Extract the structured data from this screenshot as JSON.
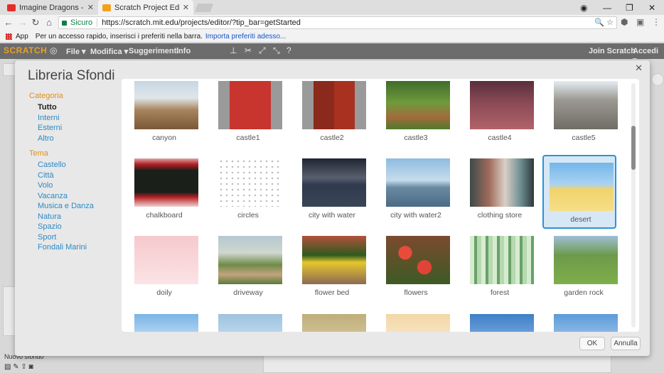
{
  "browser": {
    "tabs": [
      {
        "title": "Imagine Dragons - Go",
        "active": false,
        "favicon_color": "#e52d27"
      },
      {
        "title": "Scratch Project Editor - I",
        "active": true,
        "favicon_color": "#f4a01c"
      }
    ],
    "window_controls": {
      "user": "◉",
      "minimize": "—",
      "restore": "❐",
      "close": "✕"
    },
    "address": {
      "secure_label": "Sicuro",
      "url": "https://scratch.mit.edu/projects/editor/?tip_bar=getStarted"
    },
    "bookmarks": {
      "apps_label": "App",
      "hint": "Per un accesso rapido, inserisci i preferiti nella barra.",
      "import_link": "Importa preferiti adesso..."
    }
  },
  "scratch_bar": {
    "logo": "SCRATCH",
    "menu": [
      "File ▾",
      "Modifica ▾",
      "Suggerimenti",
      "Info"
    ],
    "join": "Join Scratch",
    "signin": "Accedi ▾"
  },
  "editor": {
    "new_background_label": "Nuovo sfondo"
  },
  "modal": {
    "title": "Libreria Sfondi",
    "category_heading": "Categoria",
    "categories": [
      "Tutto",
      "Interni",
      "Esterni",
      "Altro"
    ],
    "theme_heading": "Tema",
    "themes": [
      "Castello",
      "Città",
      "Volo",
      "Vacanza",
      "Musica e Danza",
      "Natura",
      "Spazio",
      "Sport",
      "Fondali Marini"
    ],
    "selected_category": "Tutto",
    "ok_label": "OK",
    "cancel_label": "Annulla",
    "backdrops": [
      {
        "name": "canyon",
        "selected": false
      },
      {
        "name": "castle1",
        "selected": false
      },
      {
        "name": "castle2",
        "selected": false
      },
      {
        "name": "castle3",
        "selected": false
      },
      {
        "name": "castle4",
        "selected": false
      },
      {
        "name": "castle5",
        "selected": false
      },
      {
        "name": "chalkboard",
        "selected": false
      },
      {
        "name": "circles",
        "selected": false
      },
      {
        "name": "city with water",
        "selected": false
      },
      {
        "name": "city with water2",
        "selected": false
      },
      {
        "name": "clothing store",
        "selected": false
      },
      {
        "name": "desert",
        "selected": true
      },
      {
        "name": "doily",
        "selected": false
      },
      {
        "name": "driveway",
        "selected": false
      },
      {
        "name": "flower bed",
        "selected": false
      },
      {
        "name": "flowers",
        "selected": false
      },
      {
        "name": "forest",
        "selected": false
      },
      {
        "name": "garden rock",
        "selected": false
      }
    ]
  },
  "colors": {
    "accent": "#2b93d6",
    "category_heading": "#e58e1a",
    "link": "#2b8ac7"
  }
}
